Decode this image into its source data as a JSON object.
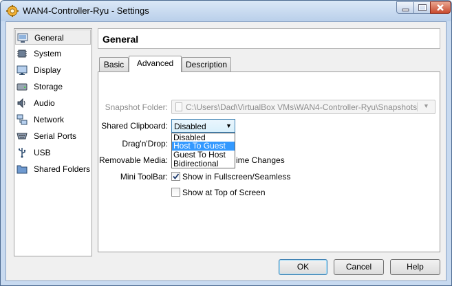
{
  "window": {
    "title": "WAN4-Controller-Ryu - Settings",
    "app_icon": "gear-cog-icon",
    "controls": [
      "minimize-icon",
      "maximize-icon",
      "close-icon"
    ]
  },
  "sidebar": {
    "items": [
      {
        "label": "General",
        "icon": "general-screen-icon",
        "selected": true
      },
      {
        "label": "System",
        "icon": "chip-icon"
      },
      {
        "label": "Display",
        "icon": "monitor-icon"
      },
      {
        "label": "Storage",
        "icon": "disk-icon"
      },
      {
        "label": "Audio",
        "icon": "speaker-icon"
      },
      {
        "label": "Network",
        "icon": "network-icon"
      },
      {
        "label": "Serial Ports",
        "icon": "serial-port-icon"
      },
      {
        "label": "USB",
        "icon": "usb-icon"
      },
      {
        "label": "Shared Folders",
        "icon": "folder-icon"
      }
    ]
  },
  "header": {
    "title": "General"
  },
  "tabs": [
    {
      "label": "Basic"
    },
    {
      "label": "Advanced",
      "active": true
    },
    {
      "label": "Description"
    }
  ],
  "advanced": {
    "snapshot_folder_label": "Snapshot Folder:",
    "snapshot_folder_value": "C:\\Users\\Dad\\VirtualBox VMs\\WAN4-Controller-Ryu\\Snapshots",
    "shared_clipboard_label": "Shared Clipboard:",
    "shared_clipboard_value": "Disabled",
    "shared_clipboard_options": [
      "Disabled",
      "Host To Guest",
      "Guest To Host",
      "Bidirectional"
    ],
    "highlighted_option": "Host To Guest",
    "dragndrop_label": "Drag'n'Drop:",
    "removable_media_label": "Removable Media:",
    "removable_media_text": "ime Changes",
    "mini_toolbar_label": "Mini ToolBar:",
    "show_fullscreen_label": "Show in Fullscreen/Seamless",
    "show_fullscreen_checked": true,
    "show_top_label": "Show at Top of Screen",
    "show_top_checked": false
  },
  "buttons": {
    "ok": "OK",
    "cancel": "Cancel",
    "help": "Help"
  },
  "colors": {
    "accent": "#3399ff",
    "title_bar": "#c8daf0",
    "close_button": "#c94a2e"
  }
}
